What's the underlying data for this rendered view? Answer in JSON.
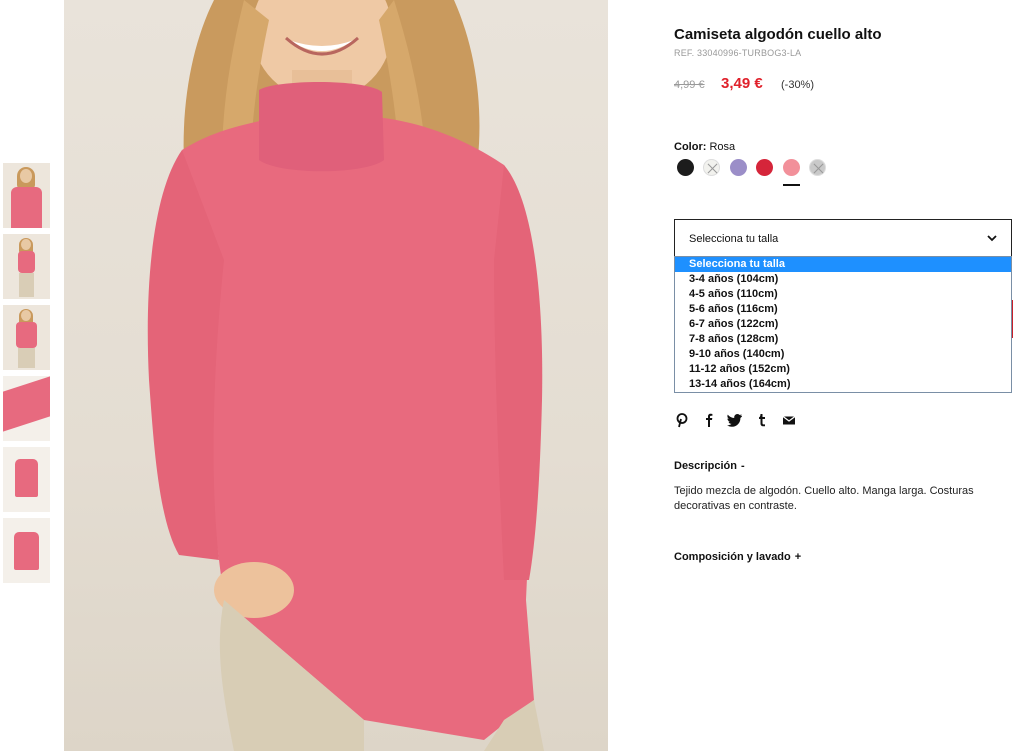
{
  "product": {
    "title": "Camiseta algodón cuello alto",
    "ref": "REF. 33040996-TURBOG3-LA",
    "old_price": "4,99 €",
    "new_price": "3,49 €",
    "discount": "(-30%)"
  },
  "color": {
    "label": "Color:",
    "selected": "Rosa",
    "swatches": [
      {
        "name": "black",
        "hex": "#1c1c1c",
        "available": true
      },
      {
        "name": "white",
        "hex": "#f2f2ee",
        "available": false
      },
      {
        "name": "lavender",
        "hex": "#9b8ec8",
        "available": true
      },
      {
        "name": "red",
        "hex": "#d5253a",
        "available": true
      },
      {
        "name": "pink",
        "hex": "#f2909a",
        "available": true,
        "selected": true
      },
      {
        "name": "grey",
        "hex": "#c9c9c9",
        "available": false
      }
    ]
  },
  "size": {
    "placeholder": "Selecciona tu talla",
    "options": [
      "Selecciona tu talla",
      "3-4 años (104cm)",
      "4-5 años (110cm)",
      "5-6 años (116cm)",
      "6-7 años (122cm)",
      "7-8 años (128cm)",
      "9-10 años (140cm)",
      "11-12 años (152cm)",
      "13-14 años (164cm)"
    ]
  },
  "social": [
    "pinterest-icon",
    "facebook-icon",
    "twitter-icon",
    "tumblr-icon",
    "email-icon"
  ],
  "description": {
    "heading": "Descripción",
    "toggle": "-",
    "text": "Tejido mezcla de algodón. Cuello alto. Manga larga. Costuras decorativas en contraste."
  },
  "composition": {
    "heading": "Composición y lavado",
    "toggle": "+"
  },
  "colors": {
    "sale_red": "#e0212b",
    "highlight_blue": "#1e90ff",
    "shirt_pink": "#e76a7f"
  }
}
